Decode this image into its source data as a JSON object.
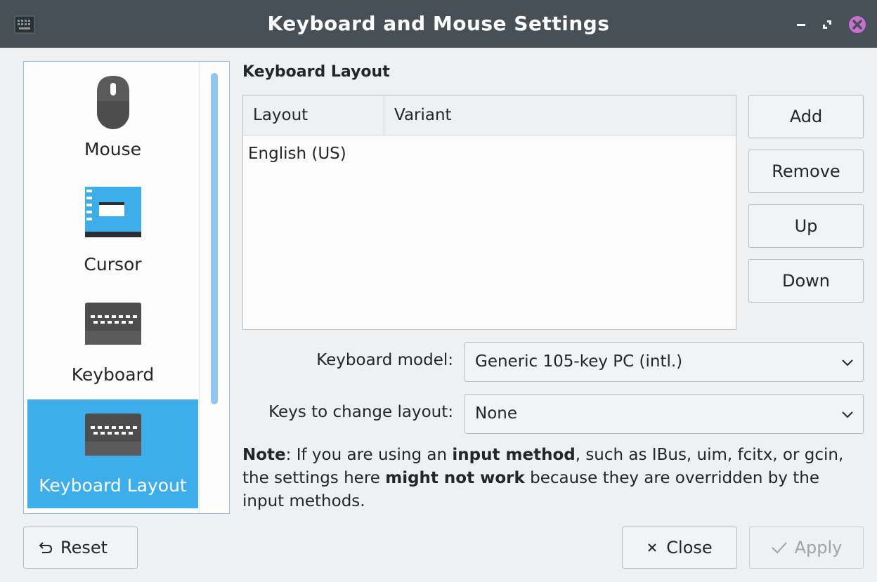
{
  "window": {
    "title": "Keyboard and Mouse Settings",
    "app_icon": "keyboard-icon",
    "controls": [
      "minimize-icon",
      "maximize-icon",
      "close-icon"
    ]
  },
  "sidebar": {
    "items": [
      {
        "label": "Mouse",
        "icon": "mouse-icon",
        "selected": false
      },
      {
        "label": "Cursor",
        "icon": "cursor-icon",
        "selected": false
      },
      {
        "label": "Keyboard",
        "icon": "keyboard-icon",
        "selected": false
      },
      {
        "label": "Keyboard Layout",
        "icon": "keyboard-layout-icon",
        "selected": true
      }
    ]
  },
  "layout_section": {
    "title": "Keyboard Layout",
    "columns": [
      "Layout",
      "Variant"
    ],
    "rows": [
      {
        "layout": "English (US)",
        "variant": ""
      }
    ],
    "buttons": {
      "add": "Add",
      "remove": "Remove",
      "up": "Up",
      "down": "Down"
    }
  },
  "keyboard_model": {
    "label": "Keyboard model:",
    "value": "Generic 105-key PC (intl.)"
  },
  "switch_keys": {
    "label": "Keys to change layout:",
    "value": "None"
  },
  "note": {
    "p1": "Note",
    "p2": ": If you are using an ",
    "p3": "input method",
    "p4": ", such as IBus, uim, fcitx, or gcin, the settings here ",
    "p5": "might not work",
    "p6": " because they are overridden by the input methods."
  },
  "footer": {
    "reset": "Reset",
    "close": "Close",
    "apply": "Apply",
    "apply_enabled": false
  },
  "colors": {
    "titlebar": "#475057",
    "selection": "#3daee9",
    "close_button": "#c86fd0",
    "window_bg": "#eff0f1"
  }
}
